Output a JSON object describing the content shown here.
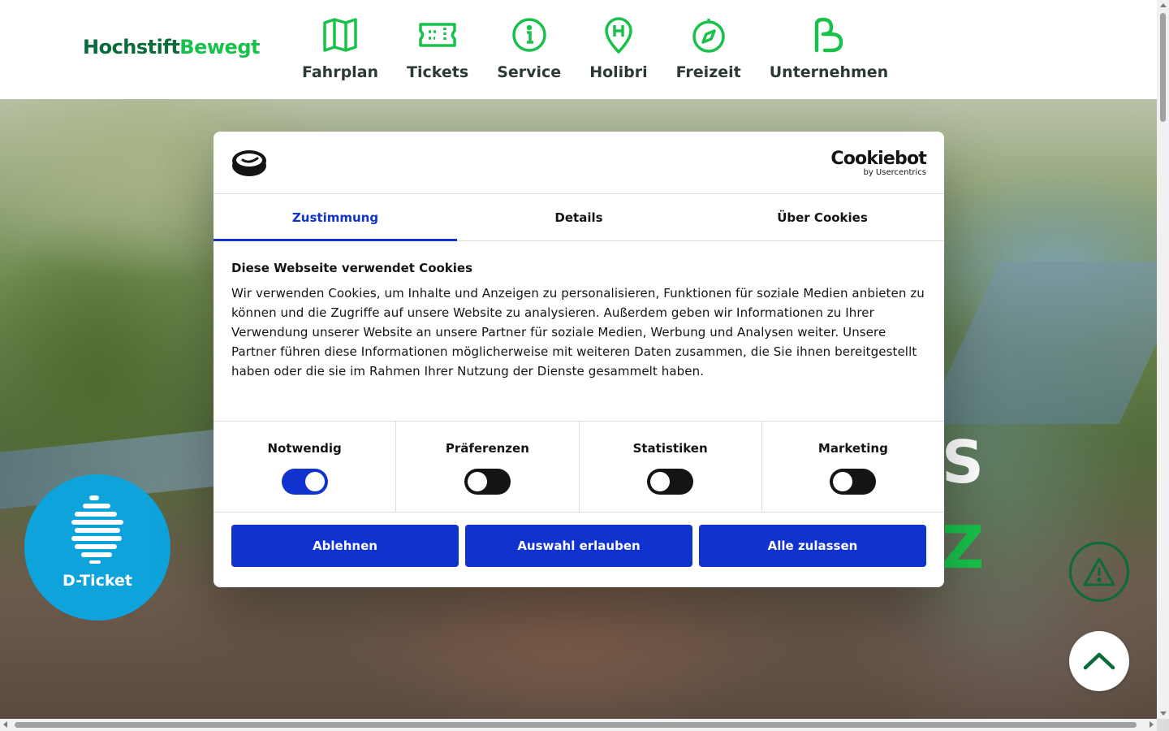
{
  "header": {
    "logo_part1": "Hochstift",
    "logo_part2": "Bewegt",
    "nav": [
      {
        "label": "Fahrplan",
        "icon": "map-icon"
      },
      {
        "label": "Tickets",
        "icon": "ticket-icon"
      },
      {
        "label": "Service",
        "icon": "info-icon"
      },
      {
        "label": "Holibri",
        "icon": "location-pin-icon"
      },
      {
        "label": "Freizeit",
        "icon": "compass-icon"
      },
      {
        "label": "Unternehmen",
        "icon": "brand-b-icon"
      }
    ],
    "accent_color": "#18c24a"
  },
  "hero": {
    "text_partial_1": "S",
    "text_partial_2": "Z"
  },
  "dticket": {
    "label": "D-Ticket",
    "color": "#0fa3dc"
  },
  "cookie_dialog": {
    "brand": "Cookiebot",
    "brand_sub": "by Usercentrics",
    "tabs": [
      "Zustimmung",
      "Details",
      "Über Cookies"
    ],
    "active_tab": "Zustimmung",
    "heading": "Diese Webseite verwendet Cookies",
    "body": "Wir verwenden Cookies, um Inhalte und Anzeigen zu personalisieren, Funktionen für soziale Medien anbieten zu können und die Zugriffe auf unsere Website zu analysieren. Außerdem geben wir Informationen zu Ihrer Verwendung unserer Website an unsere Partner für soziale Medien, Werbung und Analysen weiter. Unsere Partner führen diese Informationen möglicherweise mit weiteren Daten zusammen, die Sie ihnen bereitgestellt haben oder die sie im Rahmen Ihrer Nutzung der Dienste gesammelt haben.",
    "categories": [
      {
        "name": "Notwendig",
        "enabled": true
      },
      {
        "name": "Präferenzen",
        "enabled": false
      },
      {
        "name": "Statistiken",
        "enabled": false
      },
      {
        "name": "Marketing",
        "enabled": false
      }
    ],
    "buttons": {
      "decline": "Ablehnen",
      "allow_selection": "Auswahl erlauben",
      "allow_all": "Alle zulassen"
    },
    "primary_color": "#1032cf"
  }
}
